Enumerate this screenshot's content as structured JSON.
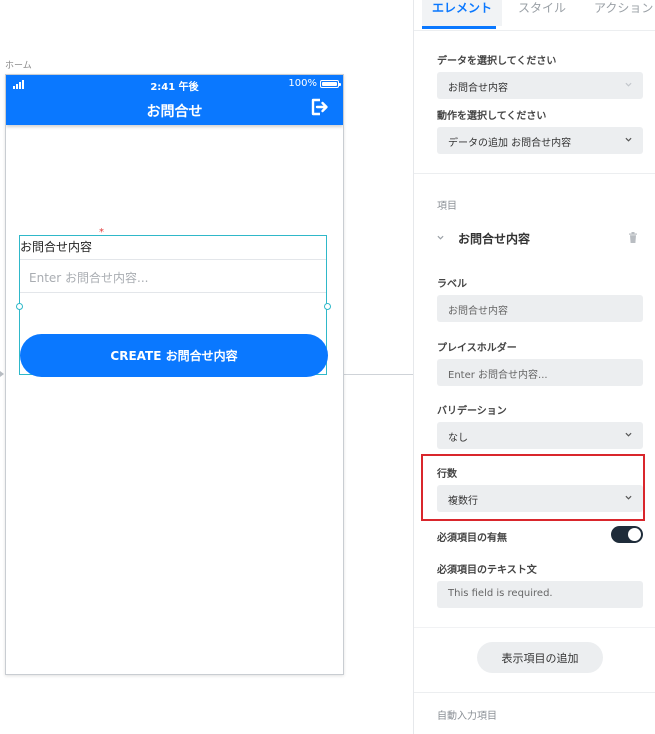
{
  "canvas": {
    "page_label": "ホーム",
    "status": {
      "time": "2:41 午後",
      "battery": "100%"
    },
    "app_title": "お問合せ",
    "form": {
      "field_label": "お問合せ内容",
      "required_mark": "*",
      "placeholder": "Enter お問合せ内容...",
      "button_label": "CREATE お問合せ内容"
    }
  },
  "panel": {
    "tabs": [
      {
        "label": "エレメント",
        "active": true
      },
      {
        "label": "スタイル",
        "active": false
      },
      {
        "label": "アクション",
        "active": false
      }
    ],
    "data_select": {
      "label": "データを選択してください",
      "value": "お問合せ内容"
    },
    "action_select": {
      "label": "動作を選択してください",
      "value": "データの追加 お問合せ内容"
    },
    "items_label": "項目",
    "item": {
      "title": "お問合せ内容",
      "label_field": {
        "label": "ラベル",
        "value": "お問合せ内容"
      },
      "placeholder_field": {
        "label": "プレイスホルダー",
        "value": "Enter お問合せ内容..."
      },
      "validation": {
        "label": "バリデーション",
        "value": "なし"
      },
      "rows": {
        "label": "行数",
        "value": "複数行"
      },
      "required_toggle": {
        "label": "必須項目の有無",
        "on": true
      },
      "required_text": {
        "label": "必須項目のテキスト文",
        "value": "This field is required."
      }
    },
    "add_button": "表示項目の追加",
    "auto_input_label": "自動入力項目"
  },
  "colors": {
    "accent": "#0a78ff",
    "highlight": "#d9262c",
    "selection": "#2fb8c9"
  }
}
